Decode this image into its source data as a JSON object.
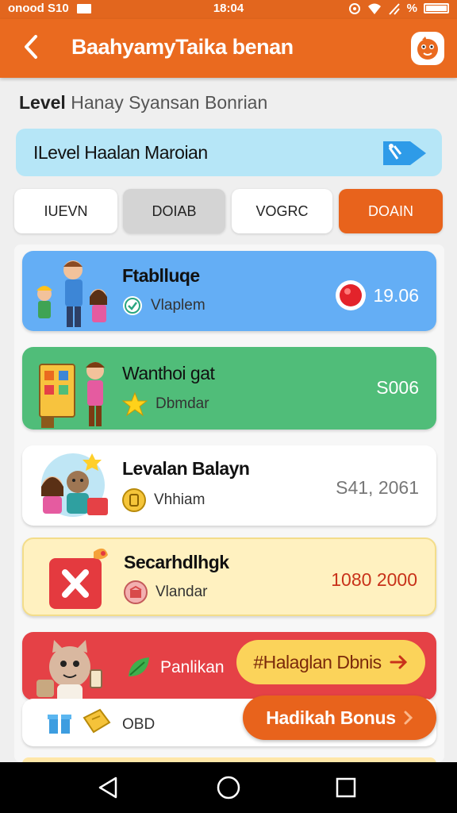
{
  "status": {
    "left_text": "onood S10",
    "time": "18:04",
    "right_text": "%",
    "colors": {
      "bar": "#e2661e"
    }
  },
  "app_bar": {
    "back_icon": "chevron-left-icon",
    "title": "BaahyamyTaika benan",
    "mascot_icon": "mascot-icon"
  },
  "subtitle": {
    "bold": "Level",
    "rest": " Hanay Syansan Bonrian"
  },
  "banner": {
    "text": "ILevel Haalan Maroian",
    "icon": "tag-arrow-icon"
  },
  "tabs": [
    {
      "label": "IUEVN"
    },
    {
      "label": "DOIAB"
    },
    {
      "label": "VOGRC"
    },
    {
      "label": "DOAIN"
    }
  ],
  "cards": [
    {
      "title": "Ftablluqe",
      "sub": "Vlaplem",
      "value": "19.06",
      "sub_icon": "check-circle-icon",
      "value_icon": "red-dot-icon",
      "bg": "#64aef5"
    },
    {
      "title": "Wanthoi gat",
      "sub": "Dbmdar",
      "value": "S006",
      "sub_icon": "star-icon",
      "bg": "#50bd79"
    },
    {
      "title": "Levalan Balayn",
      "sub": "Vhhiam",
      "value": "S41,  2061",
      "sub_icon": "coin-icon",
      "bg": "#ffffff"
    },
    {
      "title": "Secarhdlhgk",
      "sub": "Vlandar",
      "value": "1080  2000",
      "sub_icon": "gift-icon",
      "bg": "#fff1c0"
    },
    {
      "sub": "Panlikan",
      "bonus_label": "#Halaglan Dbnis",
      "sub_icon": "leaf-icon",
      "bonus_icon": "arrow-right-icon",
      "bg": "#e54146"
    }
  ],
  "bottom_card": {
    "label": "OBD",
    "button_label": "Hadikah Bonus",
    "button_icon": "chevron-right-icon"
  },
  "nav": {
    "back_icon": "triangle-back-icon",
    "home_icon": "circle-home-icon",
    "recents_icon": "square-recents-icon"
  }
}
